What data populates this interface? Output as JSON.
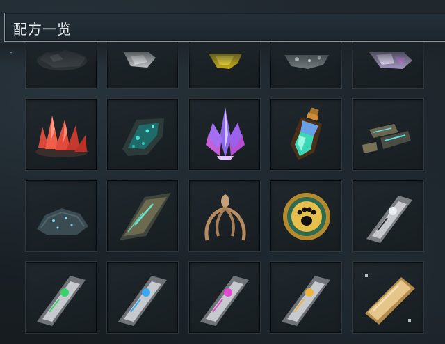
{
  "window": {
    "title": "配方一览",
    "collapse_glyph": "-"
  },
  "items": [
    {
      "icon": "dark-ore-icon"
    },
    {
      "icon": "silver-ore-icon"
    },
    {
      "icon": "gold-ore-icon"
    },
    {
      "icon": "glittering-ore-icon"
    },
    {
      "icon": "purple-crystal-ore-icon"
    },
    {
      "icon": "red-crystal-cluster-icon"
    },
    {
      "icon": "teal-ore-chunk-icon"
    },
    {
      "icon": "purple-crystal-cluster-icon"
    },
    {
      "icon": "elixir-bottle-icon"
    },
    {
      "icon": "tech-block-cluster-icon"
    },
    {
      "icon": "speckled-stone-icon"
    },
    {
      "icon": "tech-plate-icon"
    },
    {
      "icon": "bone-claw-icon"
    },
    {
      "icon": "paw-medallion-icon"
    },
    {
      "icon": "mech-module-gray-icon"
    },
    {
      "icon": "mech-module-green-icon"
    },
    {
      "icon": "mech-module-blue-icon"
    },
    {
      "icon": "mech-module-pink-icon"
    },
    {
      "icon": "mech-module-gold-icon"
    },
    {
      "icon": "gold-bar-icon"
    }
  ]
}
